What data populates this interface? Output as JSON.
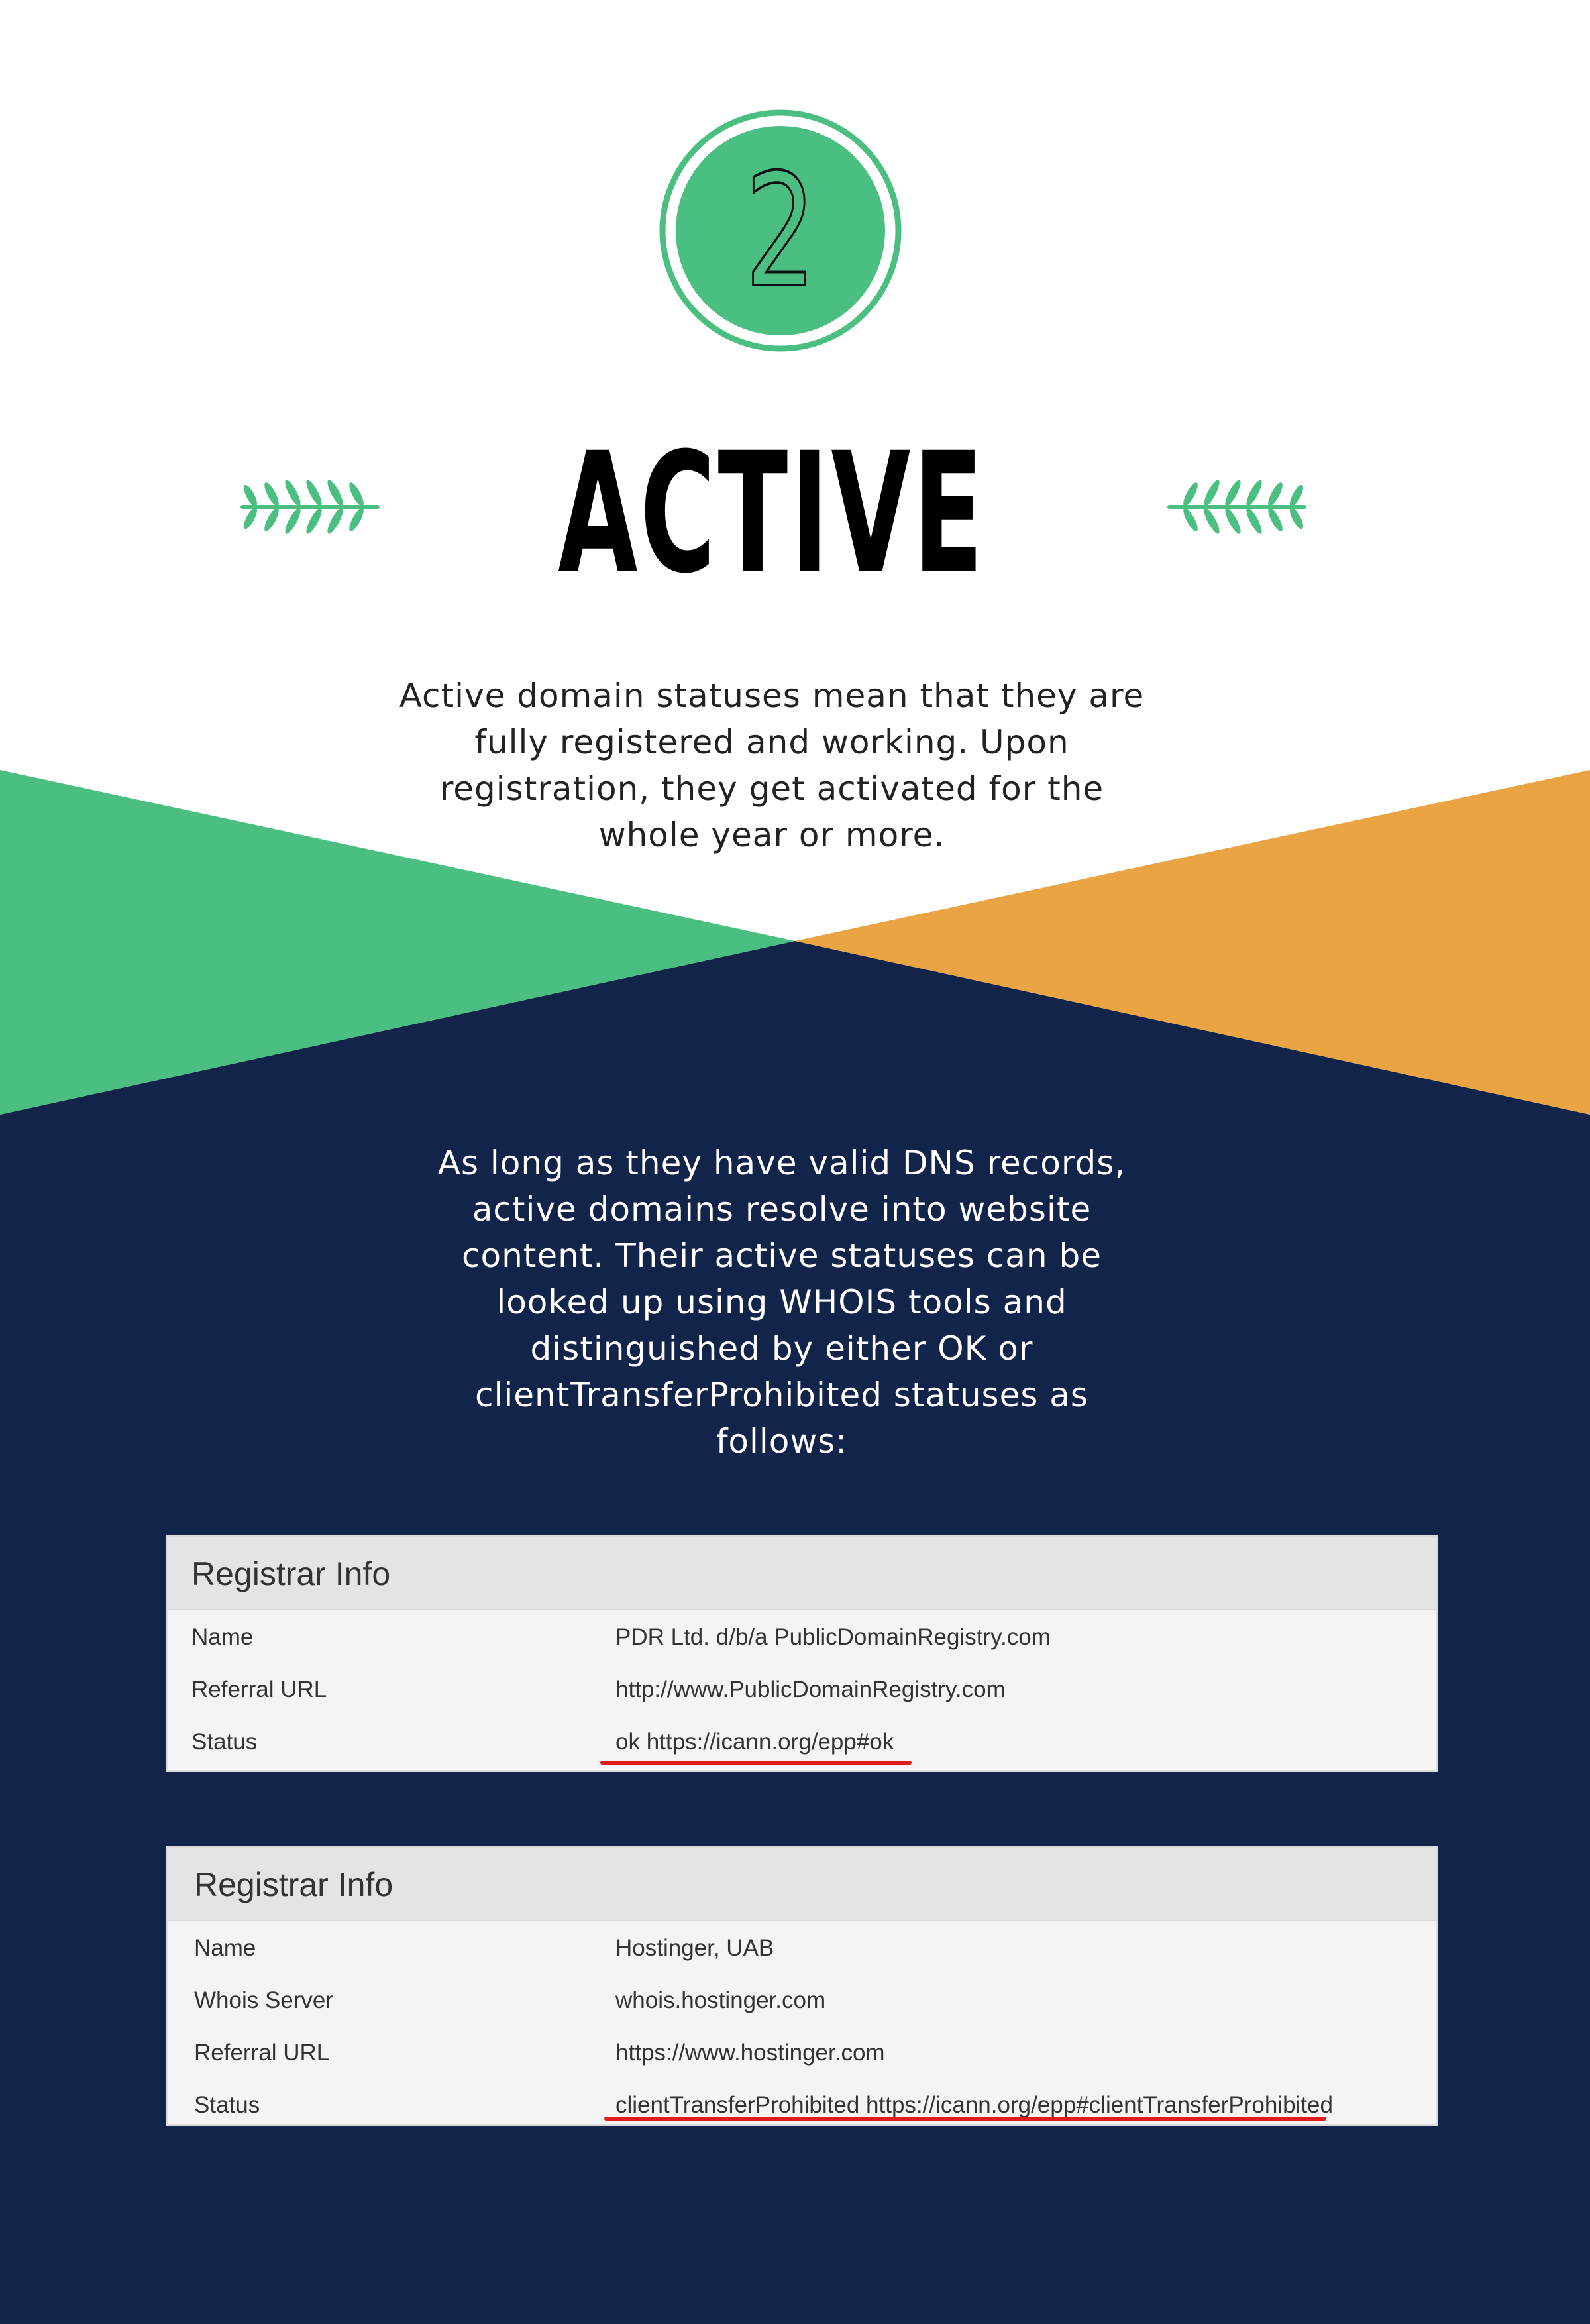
{
  "colors": {
    "green": "#4bbf81",
    "orange": "#eaa444",
    "navy": "#13244a",
    "white": "#ffffff",
    "highlight_red": "#e21b1b"
  },
  "badge": {
    "number": "2"
  },
  "heading": "ACTIVE",
  "intro_text": "Active domain statuses mean that they are fully registered and working. Upon registration, they get activated for the whole year or more.",
  "details_text": "As long as they have valid DNS records, active domains resolve into website content. Their active statuses can be looked up using WHOIS tools and distinguished by either OK or clientTransferProhibited statuses as follows:",
  "panels": [
    {
      "title": "Registrar Info",
      "rows": [
        {
          "label": "Name",
          "value": "PDR Ltd. d/b/a PublicDomainRegistry.com"
        },
        {
          "label": "Referral URL",
          "value": "http://www.PublicDomainRegistry.com"
        },
        {
          "label": "Status",
          "value": "ok https://icann.org/epp#ok",
          "highlighted": true
        }
      ]
    },
    {
      "title": "Registrar Info",
      "rows": [
        {
          "label": "Name",
          "value": "Hostinger, UAB"
        },
        {
          "label": "Whois Server",
          "value": "whois.hostinger.com"
        },
        {
          "label": "Referral URL",
          "value": "https://www.hostinger.com"
        },
        {
          "label": "Status",
          "value": "clientTransferProhibited https://icann.org/epp#clientTransferProhibited",
          "highlighted": true
        }
      ]
    }
  ]
}
